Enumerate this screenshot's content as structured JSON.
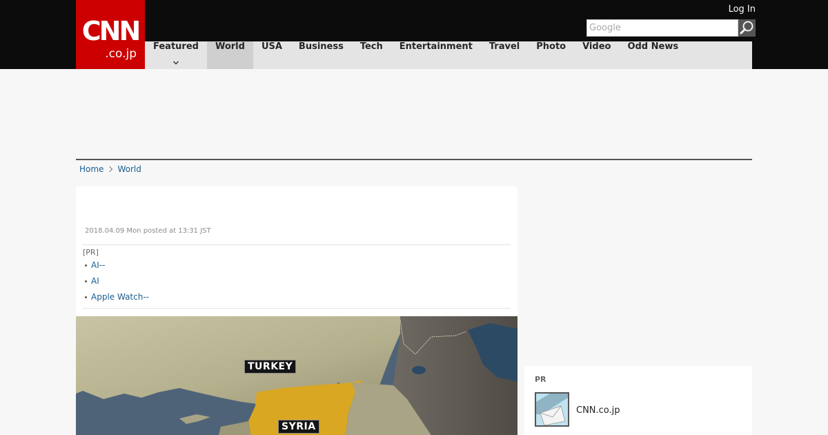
{
  "header": {
    "logo": {
      "main": "CNN",
      "sub": ".co.jp"
    },
    "login_label": "Log In",
    "search": {
      "placeholder": "Google"
    },
    "colors": {
      "topbar": "#0c0c0c",
      "logo_red": "#cc0000",
      "nav_bg": "#e4e4e4"
    }
  },
  "nav": {
    "items": [
      {
        "label": "Featured"
      },
      {
        "label": "World"
      },
      {
        "label": "USA"
      },
      {
        "label": "Business"
      },
      {
        "label": "Tech"
      },
      {
        "label": "Entertainment"
      },
      {
        "label": "Travel"
      },
      {
        "label": "Photo"
      },
      {
        "label": "Video"
      },
      {
        "label": "Odd News"
      }
    ],
    "active": "World"
  },
  "breadcrumb": [
    {
      "label": "Home"
    },
    {
      "label": "World"
    }
  ],
  "article": {
    "posted": "2018.04.09 Mon posted at 13:31 JST",
    "pr": {
      "label": "[PR]",
      "items": [
        {
          "label": "AI--"
        },
        {
          "label": "AI"
        },
        {
          "label": "Apple Watch--"
        }
      ]
    },
    "image": {
      "labels": [
        "TURKEY",
        "SYRIA"
      ]
    }
  },
  "sidebar": {
    "pr": {
      "label": "PR",
      "item_title": "CNN.co.jp"
    }
  }
}
